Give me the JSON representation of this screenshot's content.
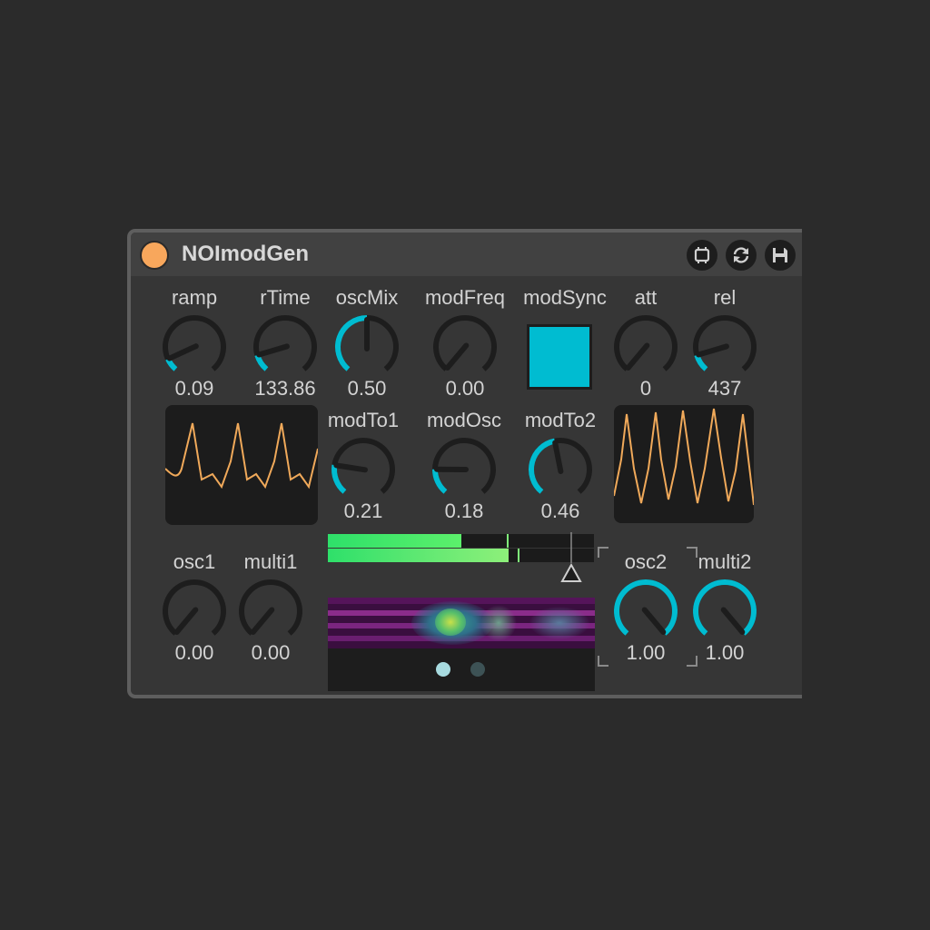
{
  "device": {
    "title": "NOImodGen",
    "buttons": [
      "clip-icon",
      "refresh-icon",
      "save-icon"
    ]
  },
  "knobs": {
    "ramp": {
      "label": "ramp",
      "value": "0.09",
      "fraction": 0.09
    },
    "rTime": {
      "label": "rTime",
      "value": "133.86",
      "fraction": 0.12
    },
    "oscMix": {
      "label": "oscMix",
      "value": "0.50",
      "fraction": 0.5
    },
    "modFreq": {
      "label": "modFreq",
      "value": "0.00",
      "fraction": 0.0
    },
    "att": {
      "label": "att",
      "value": "0",
      "fraction": 0.0
    },
    "rel": {
      "label": "rel",
      "value": "437",
      "fraction": 0.12
    },
    "modTo1": {
      "label": "modTo1",
      "value": "0.21",
      "fraction": 0.21
    },
    "modOsc": {
      "label": "modOsc",
      "value": "0.18",
      "fraction": 0.18
    },
    "modTo2": {
      "label": "modTo2",
      "value": "0.46",
      "fraction": 0.46
    },
    "osc1": {
      "label": "osc1",
      "value": "0.00",
      "fraction": 0.0
    },
    "multi1": {
      "label": "multi1",
      "value": "0.00",
      "fraction": 0.0
    },
    "osc2": {
      "label": "osc2",
      "value": "1.00",
      "fraction": 1.0
    },
    "multi2": {
      "label": "multi2",
      "value": "1.00",
      "fraction": 1.0
    }
  },
  "modSync": {
    "label": "modSync",
    "on": true
  },
  "meters": {
    "left_level": 0.5,
    "right_level": 0.68
  },
  "pager": {
    "pages": 2,
    "active": 0
  },
  "colors": {
    "accent": "#00bcd1",
    "wave": "#f0a95a",
    "power": "#f8a75c",
    "meter_green": "#5cf06b"
  }
}
